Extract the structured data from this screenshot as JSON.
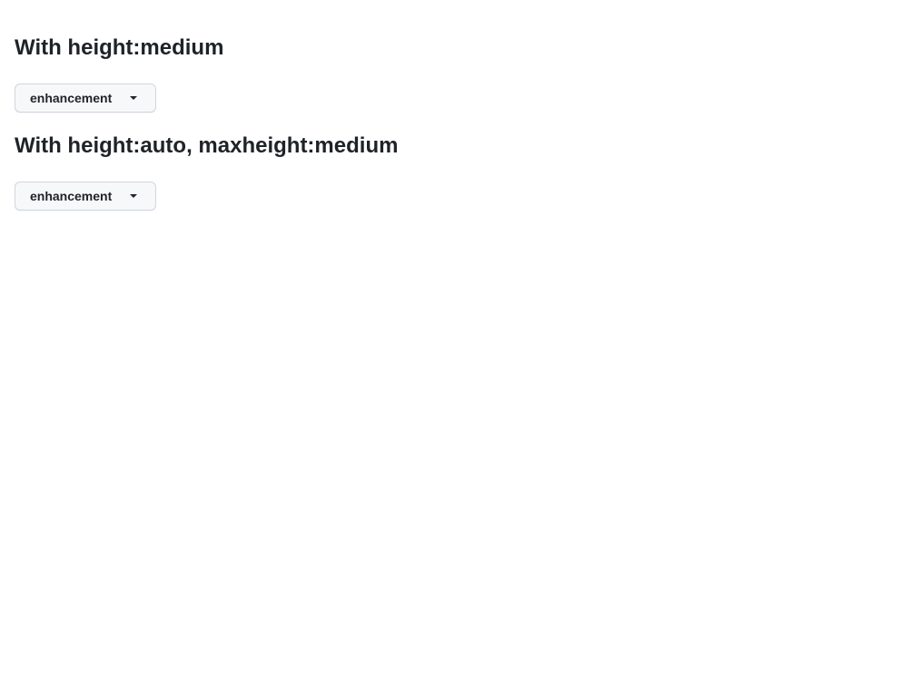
{
  "sections": [
    {
      "title": "With height:medium",
      "dropdown": {
        "label": "enhancement",
        "icon": "caret-down-icon"
      }
    },
    {
      "title": "With height:auto, maxheight:medium",
      "dropdown": {
        "label": "enhancement",
        "icon": "caret-down-icon"
      }
    }
  ]
}
